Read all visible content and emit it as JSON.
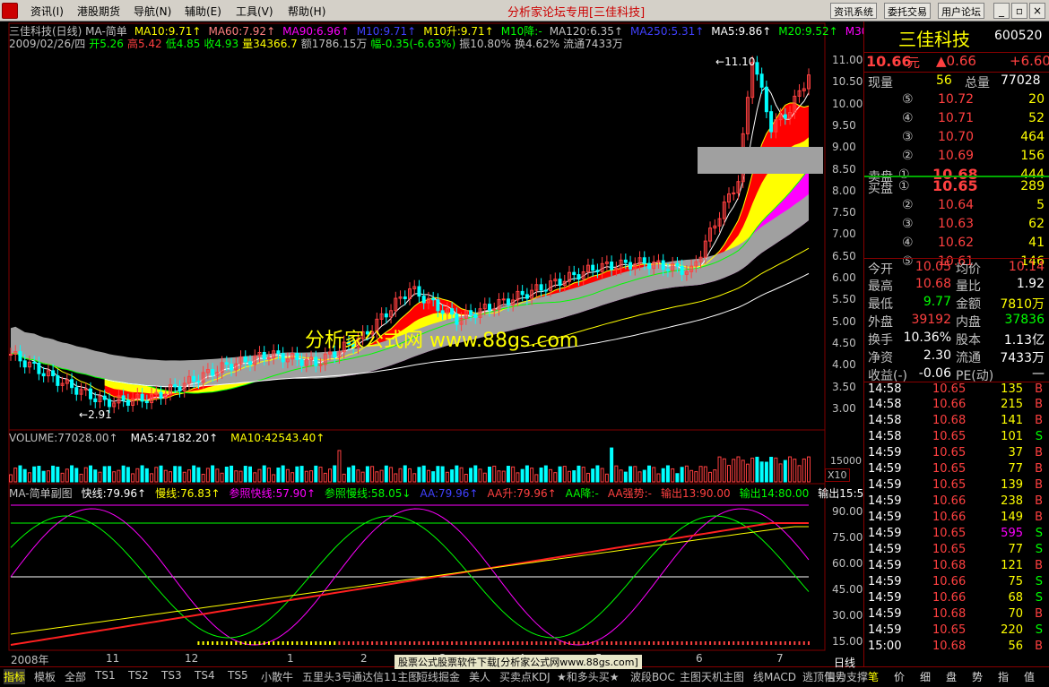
{
  "menubar": {
    "items": [
      "资讯(I)",
      "港股期货",
      "导航(N)",
      "辅助(E)",
      "工具(V)",
      "帮助(H)"
    ],
    "center_title": "分析家论坛专用[三佳科技]",
    "buttons": [
      "资讯系统",
      "委托交易",
      "用户论坛"
    ]
  },
  "header": {
    "line1": [
      {
        "text": "三佳科技(日线) MA-简单",
        "color": "#c0c0c0"
      },
      {
        "text": "MA10:9.71↑",
        "color": "#ffff00"
      },
      {
        "text": "MA60:7.92↑",
        "color": "#ff8080"
      },
      {
        "text": "MA90:6.96↑",
        "color": "#ff00ff"
      },
      {
        "text": "M10:9.71↑",
        "color": "#4040ff"
      },
      {
        "text": "M10升:9.71↑",
        "color": "#ffff00"
      },
      {
        "text": "M10降:-",
        "color": "#00ff00"
      },
      {
        "text": "MA120:6.35↑",
        "color": "#c0c0c0"
      },
      {
        "text": "MA250:5.31↑",
        "color": "#4040ff"
      },
      {
        "text": "MA5:9.86↑",
        "color": "#ffffff"
      },
      {
        "text": "M20:9.52↑",
        "color": "#00ff00"
      },
      {
        "text": "M30:9",
        "color": "#ff00ff"
      }
    ],
    "line2": [
      {
        "text": "2009/02/26/四",
        "color": "#c0c0c0"
      },
      {
        "text": "开5.26",
        "color": "#00ff00"
      },
      {
        "text": "高5.42",
        "color": "#ff4040"
      },
      {
        "text": "低4.85",
        "color": "#00ff00"
      },
      {
        "text": "收4.93",
        "color": "#00ff00"
      },
      {
        "text": "量34366.7",
        "color": "#ffff00"
      },
      {
        "text": "额1786.15万",
        "color": "#c0c0c0"
      },
      {
        "text": "幅-0.35(-6.63%)",
        "color": "#00ff00"
      },
      {
        "text": "振10.80%",
        "color": "#c0c0c0"
      },
      {
        "text": "换4.62%",
        "color": "#c0c0c0"
      },
      {
        "text": "流通7433万",
        "color": "#c0c0c0"
      }
    ]
  },
  "watermark": "分析家公式网 www.88gs.com",
  "price_axis": [
    "11.00",
    "10.50",
    "10.00",
    "9.50",
    "9.00",
    "8.50",
    "8.00",
    "7.50",
    "7.00",
    "6.50",
    "6.00",
    "5.50",
    "5.00",
    "4.50",
    "4.00",
    "3.50",
    "3.00"
  ],
  "annotations": {
    "high": "11.10",
    "low": "2.91"
  },
  "volume_header": [
    {
      "text": "VOLUME:77028.00↑",
      "color": "#c0c0c0"
    },
    {
      "text": "MA5:47182.20↑",
      "color": "#ffffff"
    },
    {
      "text": "MA10:42543.40↑",
      "color": "#ffff00"
    }
  ],
  "volume_axis": {
    "top": "15000",
    "unit": "X10"
  },
  "indicator_header": [
    {
      "text": "MA-简单副图",
      "color": "#c0c0c0"
    },
    {
      "text": "快线:79.96↑",
      "color": "#ffffff"
    },
    {
      "text": "慢线:76.83↑",
      "color": "#ffff00"
    },
    {
      "text": "参照快线:57.90↑",
      "color": "#ff00ff"
    },
    {
      "text": "参照慢线:58.05↓",
      "color": "#00ff00"
    },
    {
      "text": "AA:79.96↑",
      "color": "#4040ff"
    },
    {
      "text": "AA升:79.96↑",
      "color": "#ff4040"
    },
    {
      "text": "AA降:-",
      "color": "#00ff00"
    },
    {
      "text": "AA强势:-",
      "color": "#ff4040"
    },
    {
      "text": "输出13:90.00",
      "color": "#ff4040"
    },
    {
      "text": "输出14:80.00",
      "color": "#00ff00"
    },
    {
      "text": "输出15:50.00",
      "color": "#ffffff"
    }
  ],
  "indicator_axis": [
    "90.00",
    "75.00",
    "60.00",
    "45.00",
    "30.00",
    "15.00"
  ],
  "date_axis": [
    "2008年",
    "11",
    "12",
    "1",
    "2",
    "3",
    "4",
    "5",
    "6",
    "7"
  ],
  "stock": {
    "name": "三佳科技",
    "code": "600520",
    "price": "10.66",
    "unit": "元",
    "change": "▲0.66",
    "change_pct": "+6.60",
    "now_vol_label": "现量",
    "now_vol": "56",
    "total_vol_label": "总量",
    "total_vol": "77028"
  },
  "sell": [
    {
      "lvl": "⑤",
      "price": "10.72",
      "vol": "20"
    },
    {
      "lvl": "④",
      "price": "10.71",
      "vol": "52"
    },
    {
      "lvl": "③",
      "price": "10.70",
      "vol": "464"
    },
    {
      "lvl": "②",
      "price": "10.69",
      "vol": "156"
    },
    {
      "lvl": "①",
      "price": "10.68",
      "vol": "444",
      "label": "卖盘"
    }
  ],
  "buy": [
    {
      "lvl": "①",
      "price": "10.65",
      "vol": "289",
      "label": "买盘"
    },
    {
      "lvl": "②",
      "price": "10.64",
      "vol": "5"
    },
    {
      "lvl": "③",
      "price": "10.63",
      "vol": "62"
    },
    {
      "lvl": "④",
      "price": "10.62",
      "vol": "41"
    },
    {
      "lvl": "⑤",
      "price": "10.61",
      "vol": "146"
    }
  ],
  "stats": [
    {
      "l1": "今开",
      "v1": "10.05",
      "c1": "#ff4040",
      "l2": "均价",
      "v2": "10.14",
      "c2": "#ff4040"
    },
    {
      "l1": "最高",
      "v1": "10.68",
      "c1": "#ff4040",
      "l2": "量比",
      "v2": "1.92",
      "c2": "#ffffff"
    },
    {
      "l1": "最低",
      "v1": "9.77",
      "c1": "#00ff00",
      "l2": "金额",
      "v2": "7810万",
      "c2": "#ffff00"
    },
    {
      "l1": "外盘",
      "v1": "39192",
      "c1": "#ff4040",
      "l2": "内盘",
      "v2": "37836",
      "c2": "#00ff00"
    },
    {
      "l1": "换手",
      "v1": "10.36%",
      "c1": "#ffffff",
      "l2": "股本",
      "v2": "1.13亿",
      "c2": "#ffffff"
    },
    {
      "l1": "净资",
      "v1": "2.30",
      "c1": "#ffffff",
      "l2": "流通",
      "v2": "7433万",
      "c2": "#ffffff"
    },
    {
      "l1": "收益(-)",
      "v1": "-0.06",
      "c1": "#ffffff",
      "l2": "PE(动)",
      "v2": "—",
      "c2": "#ffffff"
    }
  ],
  "ticks": [
    {
      "t": "14:58",
      "p": "10.65",
      "v": "135",
      "s": "B",
      "pc": "#ff4040",
      "vc": "#ffff00"
    },
    {
      "t": "14:58",
      "p": "10.66",
      "v": "215",
      "s": "B",
      "pc": "#ff4040",
      "vc": "#ffff00"
    },
    {
      "t": "14:58",
      "p": "10.68",
      "v": "141",
      "s": "B",
      "pc": "#ff4040",
      "vc": "#ffff00"
    },
    {
      "t": "14:58",
      "p": "10.65",
      "v": "101",
      "s": "S",
      "pc": "#ff4040",
      "vc": "#ffff00"
    },
    {
      "t": "14:59",
      "p": "10.65",
      "v": "37",
      "s": "B",
      "pc": "#ff4040",
      "vc": "#ffff00"
    },
    {
      "t": "14:59",
      "p": "10.65",
      "v": "77",
      "s": "B",
      "pc": "#ff4040",
      "vc": "#ffff00"
    },
    {
      "t": "14:59",
      "p": "10.65",
      "v": "139",
      "s": "B",
      "pc": "#ff4040",
      "vc": "#ffff00"
    },
    {
      "t": "14:59",
      "p": "10.66",
      "v": "238",
      "s": "B",
      "pc": "#ff4040",
      "vc": "#ffff00"
    },
    {
      "t": "14:59",
      "p": "10.66",
      "v": "149",
      "s": "B",
      "pc": "#ff4040",
      "vc": "#ffff00"
    },
    {
      "t": "14:59",
      "p": "10.65",
      "v": "595",
      "s": "S",
      "pc": "#ff4040",
      "vc": "#ff00ff"
    },
    {
      "t": "14:59",
      "p": "10.65",
      "v": "77",
      "s": "S",
      "pc": "#ff4040",
      "vc": "#ffff00"
    },
    {
      "t": "14:59",
      "p": "10.68",
      "v": "121",
      "s": "B",
      "pc": "#ff4040",
      "vc": "#ffff00"
    },
    {
      "t": "14:59",
      "p": "10.66",
      "v": "75",
      "s": "S",
      "pc": "#ff4040",
      "vc": "#ffff00"
    },
    {
      "t": "14:59",
      "p": "10.66",
      "v": "68",
      "s": "S",
      "pc": "#ff4040",
      "vc": "#ffff00"
    },
    {
      "t": "14:59",
      "p": "10.68",
      "v": "70",
      "s": "B",
      "pc": "#ff4040",
      "vc": "#ffff00"
    },
    {
      "t": "14:59",
      "p": "10.65",
      "v": "220",
      "s": "S",
      "pc": "#ff4040",
      "vc": "#ffff00"
    },
    {
      "t": "15:00",
      "p": "10.68",
      "v": "56",
      "s": "B",
      "pc": "#ff4040",
      "vc": "#ffff00"
    }
  ],
  "bottom_tabs": [
    "指标",
    "模板",
    "全部",
    "TS1",
    "TS2",
    "TS3",
    "TS4",
    "TS5",
    "小散牛",
    "五里头3号",
    "通达信11主图",
    "短线掘金",
    "美人",
    "买卖点KDJ",
    "★和多头买★",
    "波段BOC",
    "主图天机主图",
    "线MACD",
    "逃顶信号",
    "阻力支撑"
  ],
  "bottom_mid": "股票公式股票软件下载[分析家公式网www.88gs.com]",
  "bottom_right_label": "日线",
  "right_tabs": [
    "笔",
    "价",
    "细",
    "盘",
    "势",
    "指",
    "值"
  ]
}
